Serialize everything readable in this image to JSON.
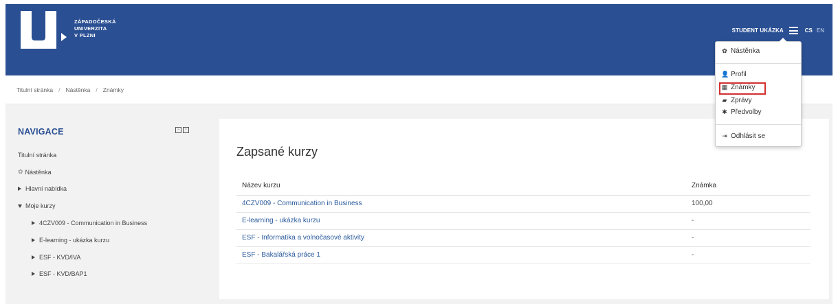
{
  "header": {
    "logo_lines": [
      "ZÁPADOČESKÁ",
      "UNIVERZITA",
      "V PLZNI"
    ],
    "user_name": "STUDENT UKÁZKA",
    "lang_active": "CS",
    "lang_other": "EN",
    "colors": {
      "brand": "#2a4f93",
      "link": "#2a5a9c",
      "highlight": "#d32f2f"
    }
  },
  "breadcrumb": [
    "Titulní stránka",
    "Nástěnka",
    "Známky"
  ],
  "navigation": {
    "title": "NAVIGACE",
    "items": [
      "Titulní stránka",
      "Nástěnka",
      "Hlavní nabídka",
      "Moje kurzy"
    ],
    "courses": [
      "4CZV009 - Communication in Business",
      "E-learning - ukázka kurzu",
      "ESF - KVD/IVA",
      "ESF - KVD/BAP1"
    ]
  },
  "main": {
    "title": "Zapsané kurzy",
    "columns": [
      "Název kurzu",
      "Známka"
    ],
    "rows": [
      {
        "course": "4CZV009 - Communication in Business",
        "grade": "100,00"
      },
      {
        "course": "E-learning - ukázka kurzu",
        "grade": "-"
      },
      {
        "course": "ESF - Informatika a volnočasové aktivity",
        "grade": "-"
      },
      {
        "course": "ESF - Bakalářská práce 1",
        "grade": "-"
      }
    ]
  },
  "user_menu": {
    "items": [
      "Nástěnka",
      "Profil",
      "Známky",
      "Zprávy",
      "Předvolby",
      "Odhlásit se"
    ],
    "icons": [
      "dashboard-icon",
      "user-icon",
      "grades-table-icon",
      "message-icon",
      "gear-icon",
      "logout-icon"
    ]
  }
}
